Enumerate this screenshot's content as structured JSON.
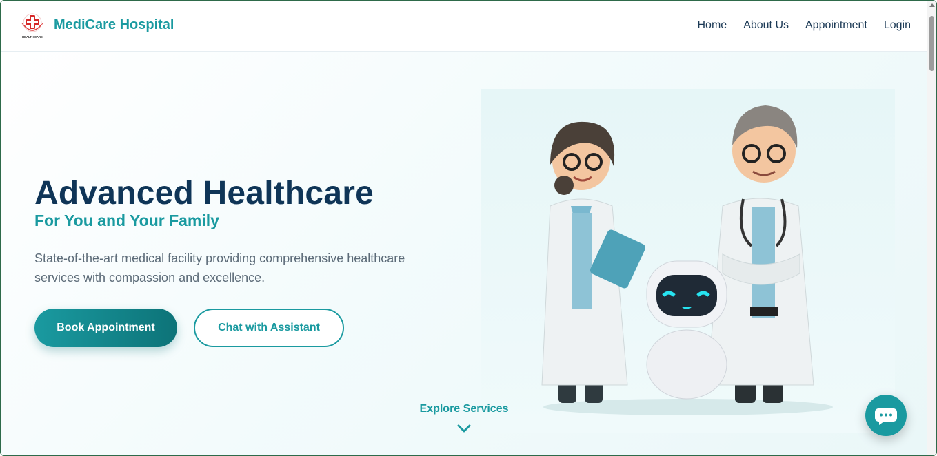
{
  "header": {
    "brand_name": "MediCare Hospital",
    "logo_text": "HEALTH CARE",
    "nav": [
      {
        "label": "Home"
      },
      {
        "label": "About Us"
      },
      {
        "label": "Appointment"
      },
      {
        "label": "Login"
      }
    ]
  },
  "hero": {
    "title": "Advanced Healthcare",
    "subtitle": "For You and Your Family",
    "description": "State-of-the-art medical facility providing comprehensive healthcare services with compassion and excellence.",
    "primary_button": "Book Appointment",
    "secondary_button": "Chat with Assistant",
    "explore_label": "Explore Services"
  },
  "icons": {
    "logo": "medical-cross-logo-icon",
    "explore": "chevron-down-icon",
    "chat_fab": "chat-bubble-icon"
  },
  "colors": {
    "brand_teal": "#1a9aa0",
    "brand_teal_dark": "#0d7378",
    "navy": "#0f3557",
    "body_text": "#5c6b78"
  }
}
